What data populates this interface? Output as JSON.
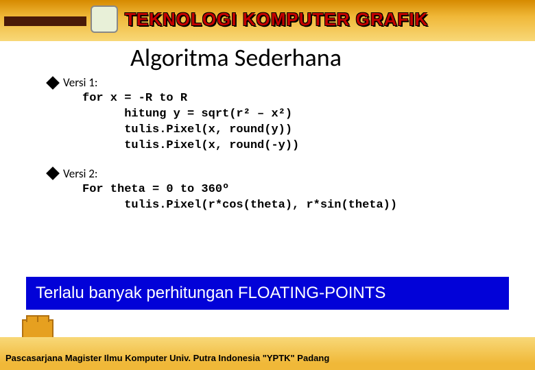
{
  "header": {
    "brand": "TEKNOLOGI KOMPUTER GRAFIK"
  },
  "page": {
    "title": "Algoritma Sederhana"
  },
  "sections": [
    {
      "label": "Versi 1:",
      "code": "for x = -R to R\n      hitung y = sqrt(r² – x²)\n      tulis.Pixel(x, round(y))\n      tulis.Pixel(x, round(-y))"
    },
    {
      "label": "Versi 2:",
      "code": "For theta = 0 to 360º\n      tulis.Pixel(r*cos(theta), r*sin(theta))"
    }
  ],
  "highlight": "Terlalu banyak perhitungan FLOATING-POINTS",
  "footer": "Pascasarjana Magister Ilmu Komputer  Univ. Putra Indonesia \"YPTK\" Padang"
}
